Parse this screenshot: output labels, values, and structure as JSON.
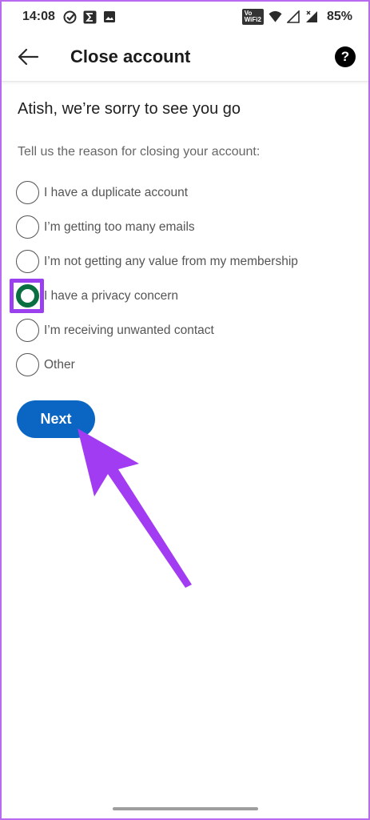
{
  "status_bar": {
    "time": "14:08",
    "left_icons": [
      "check-circle-icon",
      "sigma-icon",
      "image-icon"
    ],
    "volte_top": "Vo",
    "volte_bottom": "WiFi2",
    "battery": "85%"
  },
  "app_bar": {
    "title": "Close account",
    "back_icon": "arrow-left-icon",
    "help_icon": "question-circle-icon"
  },
  "main": {
    "heading": "Atish, we’re sorry to see you go",
    "prompt": "Tell us the reason for closing your account:",
    "options": [
      {
        "label": "I have a duplicate account",
        "selected": false
      },
      {
        "label": "I’m getting too many emails",
        "selected": false
      },
      {
        "label": "I’m not getting any value from my membership",
        "selected": false
      },
      {
        "label": "I have a privacy concern",
        "selected": true
      },
      {
        "label": "I’m receiving unwanted contact",
        "selected": false
      },
      {
        "label": "Other",
        "selected": false
      }
    ],
    "next_label": "Next"
  },
  "colors": {
    "primary": "#0a66c2",
    "radio_selected": "#0a7042",
    "annotation": "#9b40ef"
  }
}
